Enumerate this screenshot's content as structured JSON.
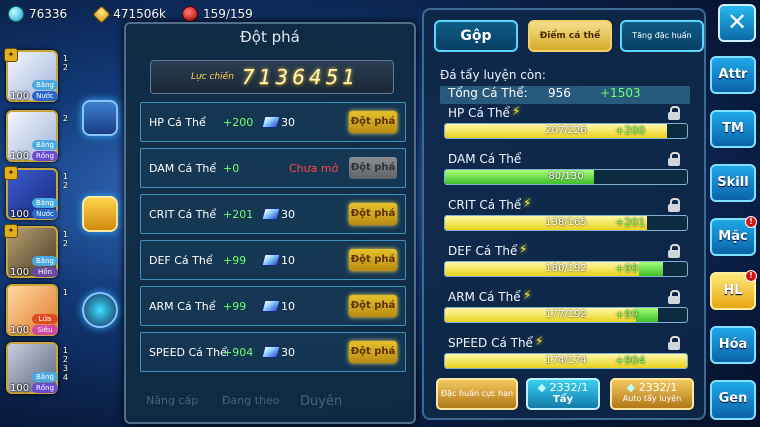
{
  "resources": {
    "gems": "76336",
    "gold": "471506k",
    "stamina": "159/159"
  },
  "roster": [
    {
      "level": "100",
      "element": "Băng",
      "element2": "Nước",
      "nums": [
        "1",
        "2"
      ]
    },
    {
      "level": "100",
      "element": "Băng",
      "element2": "Rồng",
      "nums": [
        "2"
      ]
    },
    {
      "level": "100",
      "element": "Băng",
      "element2": "Nước",
      "nums": [
        "1",
        "2"
      ]
    },
    {
      "level": "100",
      "element": "Băng",
      "element2": "Hồn",
      "nums": [
        "1",
        "2"
      ]
    },
    {
      "level": "100",
      "element": "Lửa",
      "element2": "Siêu",
      "nums": [
        "1"
      ]
    },
    {
      "level": "100",
      "element": "Băng",
      "element2": "Rồng",
      "nums": [
        "1",
        "2",
        "3",
        "4"
      ]
    }
  ],
  "left_panel": {
    "title": "Đột phá",
    "power_label": "Lực chiến",
    "power_value": "7136451",
    "rows": [
      {
        "stat": "HP Cá Thể",
        "add": "+200",
        "cost": "30",
        "button": "Đột phá",
        "enabled": true
      },
      {
        "stat": "DAM Cá Thể",
        "add": "+0",
        "status": "Chưa mở",
        "button": "Đột phá",
        "enabled": false
      },
      {
        "stat": "CRIT Cá Thể",
        "add": "+201",
        "cost": "30",
        "button": "Đột phá",
        "enabled": true
      },
      {
        "stat": "DEF Cá Thể",
        "add": "+99",
        "cost": "10",
        "button": "Đột phá",
        "enabled": true
      },
      {
        "stat": "ARM Cá Thể",
        "add": "+99",
        "cost": "10",
        "button": "Đột phá",
        "enabled": true
      },
      {
        "stat": "SPEED Cá Thể",
        "add": "+904",
        "cost": "30",
        "button": "Đột phá",
        "enabled": true
      }
    ],
    "faded": [
      "Nâng cấp",
      "Đang theo",
      "Duyên"
    ]
  },
  "right_panel": {
    "tabs": [
      "Gộp",
      "Điểm cá thể",
      "Tăng đặc huấn"
    ],
    "remaining_label": "Đá tẩy luyện còn:",
    "total_label": "Tổng Cá Thể:",
    "total_value": "956",
    "total_add": "+1503",
    "bars": [
      {
        "label": "HP Cá Thể",
        "value": "207/226",
        "plus": "+200",
        "fill": 0.916,
        "bonus": 0.0
      },
      {
        "label": "DAM Cá Thể",
        "value": "80/130",
        "plus": "",
        "fill": 0.615,
        "bonus": 0.0
      },
      {
        "label": "CRIT Cá Thể",
        "value": "138/165",
        "plus": "+201",
        "fill": 0.836,
        "bonus": 0.0
      },
      {
        "label": "DEF Cá Thể",
        "value": "180/192",
        "plus": "+99",
        "fill": 0.8,
        "bonus": 0.1
      },
      {
        "label": "ARM Cá Thể",
        "value": "177/192",
        "plus": "+99",
        "fill": 0.79,
        "bonus": 0.09
      },
      {
        "label": "SPEED Cá Thể",
        "value": "174/174",
        "plus": "+904",
        "fill": 1.0,
        "bonus": 0.0
      }
    ],
    "buttons": {
      "special": "Đặc huấn cực hạn",
      "wash_count": "2332/1",
      "wash": "Tẩy",
      "auto_count": "2332/1",
      "auto": "Auto tẩy luyện"
    }
  },
  "nav": [
    "Attr",
    "TM",
    "Skill",
    "Mặc",
    "HL",
    "Hóa",
    "Gen"
  ]
}
